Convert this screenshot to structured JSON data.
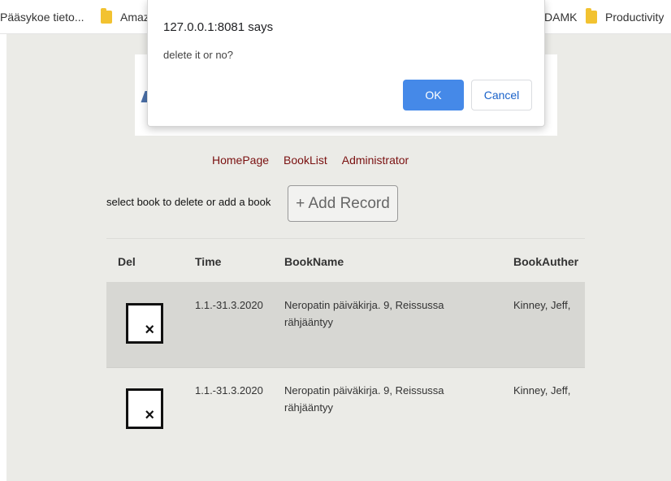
{
  "bookmarks": [
    {
      "label": "Pääsykoe tieto..."
    },
    {
      "label": "Amaz"
    },
    {
      "label": "DAMK"
    },
    {
      "label": "Productivity"
    }
  ],
  "dialog": {
    "title": "127.0.0.1:8081 says",
    "message": "delete it or no?",
    "ok_label": "OK",
    "cancel_label": "Cancel"
  },
  "nav": {
    "homepage": "HomePage",
    "booklist": "BookList",
    "administrator": "Administrator"
  },
  "toolbar": {
    "prompt": "select book to delete or add a book",
    "add_label": "+ Add Record"
  },
  "table": {
    "headers": {
      "del": "Del",
      "time": "Time",
      "bookname": "BookName",
      "author": "BookAuther"
    },
    "rows": [
      {
        "time": "1.1.-31.3.2020",
        "bookname": "Neropatin päiväkirja. 9, Reissussa rähjääntyy",
        "author": "Kinney, Jeff,"
      },
      {
        "time": "1.1.-31.3.2020",
        "bookname": "Neropatin päiväkirja. 9, Reissussa rähjääntyy",
        "author": "Kinney, Jeff,"
      }
    ]
  },
  "colors": {
    "page_bg": "#ebebe7",
    "nav_link": "#7a1010",
    "ok_button": "#4589e8",
    "row_shade": "#d7d7d3"
  }
}
